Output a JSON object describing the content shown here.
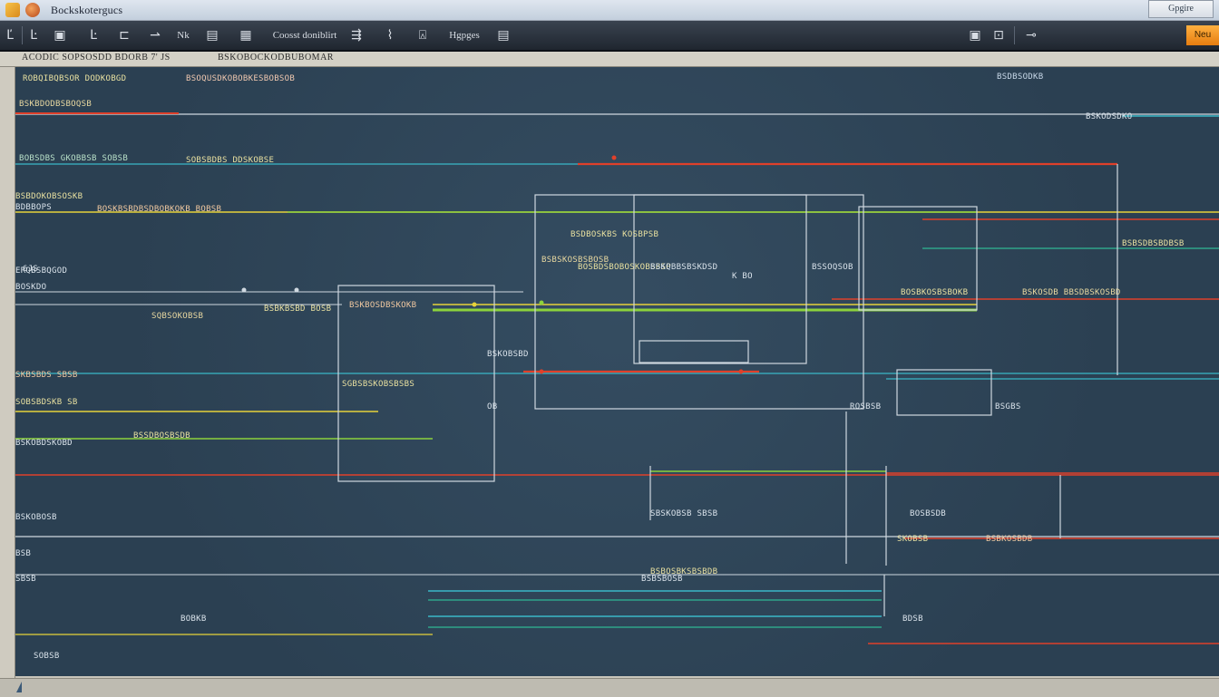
{
  "window": {
    "title": "Bockskotergucs",
    "title_button": "Gpgire"
  },
  "toolbar": {
    "buttons": [
      {
        "name": "back-button",
        "label": "Ľ"
      },
      {
        "name": "doc-button",
        "label": "Ŀ"
      },
      {
        "name": "image-button",
        "label": "▣"
      },
      {
        "name": "text-tool-button",
        "label": "Ŀ"
      },
      {
        "name": "grid-button",
        "label": "⊏"
      },
      {
        "name": "pen-button",
        "label": "⇀"
      },
      {
        "name": "node-button",
        "label": "Nk"
      },
      {
        "name": "align-button",
        "label": "▤"
      },
      {
        "name": "panel-button",
        "label": "▦"
      },
      {
        "name": "connect-label",
        "label": "Coosst doniblirt"
      },
      {
        "name": "route-button",
        "label": "⇶"
      },
      {
        "name": "mouse-button",
        "label": "⌇"
      },
      {
        "name": "stamp-button",
        "label": "⍓"
      },
      {
        "name": "hypgrs-label",
        "label": "Hgpges"
      },
      {
        "name": "layers-button",
        "label": "▤"
      },
      {
        "name": "export-button",
        "label": "▣"
      },
      {
        "name": "lock-button",
        "label": "⊡"
      },
      {
        "name": "wire-button",
        "label": "⊸"
      }
    ],
    "accent_label": "Neu"
  },
  "ruler": {
    "left_label": "ACODIC  SOPSOSDD BDORB 7' JS",
    "mid_label": "BSKOBOCKODBUBOMAR"
  },
  "canvas": {
    "labels": [
      {
        "text": "ROBQIBQBSOR DODKOBGD",
        "color": "#e8e0a0"
      },
      {
        "text": "BSOQUSDKOBOBKESBOBSOB",
        "color": "#f0c8b0"
      },
      {
        "text": "BSDBSODKB",
        "color": "#c8d8e8"
      },
      {
        "text": "BSKBDODBSBOQSB",
        "color": "#e8d8a0"
      },
      {
        "text": "BOBSDBS GKOBBSB SOBSB",
        "color": "#b8e0c8"
      },
      {
        "text": "SOBSBDBS DDSKOBSE",
        "color": "#e8e0a0"
      },
      {
        "text": "BSKODSDKO",
        "color": "#d9e2ea"
      },
      {
        "text": "BSBDOKOBSOSKB",
        "color": "#e8e0a0"
      },
      {
        "text": "BDBBOPS",
        "color": "#d9e2ea"
      },
      {
        "text": "BOSKBSBDBSDBOBKOKB BOBSB",
        "color": "#f0c8a0"
      },
      {
        "text": "BSDBOSKBS KOSBPSB",
        "color": "#e8e0a0"
      },
      {
        "text": "BOSBDSBOBOSKOBSBSP",
        "color": "#e8e0a0"
      },
      {
        "text": "ERQBSBQGOD",
        "color": "#d9e2ea"
      },
      {
        "text": "BOSKDO",
        "color": "#d9e2ea"
      },
      {
        "text": "SQBSOKOBSB",
        "color": "#e8d8a0"
      },
      {
        "text": "BSBKBSBD BOSB",
        "color": "#e8e0a0"
      },
      {
        "text": "BSKBOSDBSKOKB",
        "color": "#f0c8a0"
      },
      {
        "text": "BSBSKOSBSBOSB",
        "color": "#e8d8a0"
      },
      {
        "text": "BSKQBBSBSKDSD",
        "color": "#d9e2ea"
      },
      {
        "text": "BSSOQSOB",
        "color": "#d9e2ea"
      },
      {
        "text": "BOSBKOSBSBOKB",
        "color": "#e8e0a0"
      },
      {
        "text": "BSKOSDB BBSDBSKOSBD",
        "color": "#e8d8a0"
      },
      {
        "text": "SKBSBDS SBSB",
        "color": "#f0c8a0"
      },
      {
        "text": "SOBSBDSKB SB",
        "color": "#e8e0a0"
      },
      {
        "text": "BSKOBDSKOBD",
        "color": "#d9e2ea"
      },
      {
        "text": "BSSDBOSBSDB",
        "color": "#e8e0a0"
      },
      {
        "text": "SGBSBSKOBSBSBS",
        "color": "#e8e0a0"
      },
      {
        "text": "BSKOBSBD",
        "color": "#d9e2ea"
      },
      {
        "text": "SBSKOBSB SBSB",
        "color": "#d9e2ea"
      },
      {
        "text": "BSBOSBKSBSBDB",
        "color": "#e8e0a0"
      },
      {
        "text": "BOSBSDB",
        "color": "#d9e2ea"
      },
      {
        "text": "SKOBSB",
        "color": "#e8e0a0"
      },
      {
        "text": "BSBKOSBDB",
        "color": "#f0c8a0"
      },
      {
        "text": "BSKOBOSB",
        "color": "#d9e2ea"
      },
      {
        "text": "BSB",
        "color": "#d9e2ea"
      },
      {
        "text": "SBSB",
        "color": "#d9e2ea"
      },
      {
        "text": "BSBSBOSB",
        "color": "#d9e2ea"
      },
      {
        "text": "BOBKB",
        "color": "#d9e2ea"
      },
      {
        "text": "SOBSB",
        "color": "#d9e2ea"
      },
      {
        "text": "BDSB",
        "color": "#d9e2ea"
      },
      {
        "text": "6JS",
        "color": "#d9e2ea"
      },
      {
        "text": "OB",
        "color": "#d9e2ea"
      },
      {
        "text": "K  BO",
        "color": "#d9e2ea"
      },
      {
        "text": "BSBSDBSBDBSB",
        "color": "#e8e0a0"
      },
      {
        "text": "ROSBSB",
        "color": "#d9e2ea"
      },
      {
        "text": "BSGBS",
        "color": "#d9e2ea"
      }
    ]
  },
  "colors": {
    "canvas_bg": "#2b4052",
    "wire_white": "#cfd8e0",
    "wire_red": "#e0402a",
    "wire_green": "#8cd23c",
    "wire_yellow": "#e6d23a",
    "wire_cyan": "#3ab8c8",
    "wire_teal": "#2fa48a"
  }
}
